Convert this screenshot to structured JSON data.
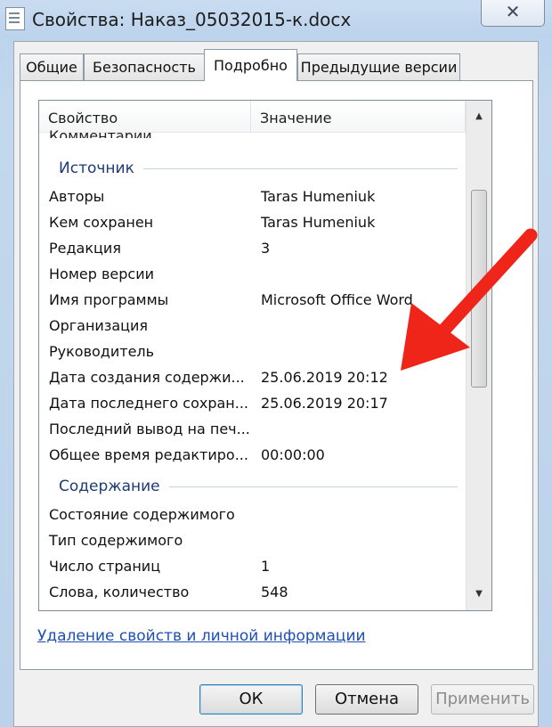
{
  "window": {
    "title": "Свойства: Наказ_05032015-к.docx",
    "close_icon": "close-icon",
    "title_icon": "document-icon"
  },
  "tabs": [
    {
      "label": "Общие",
      "active": false
    },
    {
      "label": "Безопасность",
      "active": false
    },
    {
      "label": "Подробно",
      "active": true
    },
    {
      "label": "Предыдущие версии",
      "active": false
    }
  ],
  "list": {
    "header_property": "Свойство",
    "header_value": "Значение",
    "partial_row": "Комментарии",
    "groups": [
      {
        "label": "Источник",
        "rows": [
          {
            "k": "Авторы",
            "v": "Taras Humeniuk"
          },
          {
            "k": "Кем сохранен",
            "v": "Taras Humeniuk"
          },
          {
            "k": "Редакция",
            "v": "3"
          },
          {
            "k": "Номер версии",
            "v": ""
          },
          {
            "k": "Имя программы",
            "v": "Microsoft Office Word"
          },
          {
            "k": "Организация",
            "v": ""
          },
          {
            "k": "Руководитель",
            "v": ""
          },
          {
            "k": "Дата создания содержи...",
            "v": "25.06.2019 20:12"
          },
          {
            "k": "Дата последнего сохран...",
            "v": "25.06.2019 20:17"
          },
          {
            "k": "Последний вывод на печ...",
            "v": ""
          },
          {
            "k": "Общее время редактиро...",
            "v": "00:00:00"
          }
        ]
      },
      {
        "label": "Содержание",
        "rows": [
          {
            "k": "Состояние содержимого",
            "v": ""
          },
          {
            "k": "Тип содержимого",
            "v": ""
          },
          {
            "k": "Число страниц",
            "v": "1"
          },
          {
            "k": "Слова, количество",
            "v": "548"
          }
        ]
      }
    ]
  },
  "link_text": "Удаление свойств и личной информации",
  "buttons": {
    "ok": "ОК",
    "cancel": "Отмена",
    "apply": "Применить"
  },
  "colors": {
    "annotation_arrow": "#f0251a",
    "group_label": "#1d3b74",
    "link": "#1e4fb4"
  }
}
